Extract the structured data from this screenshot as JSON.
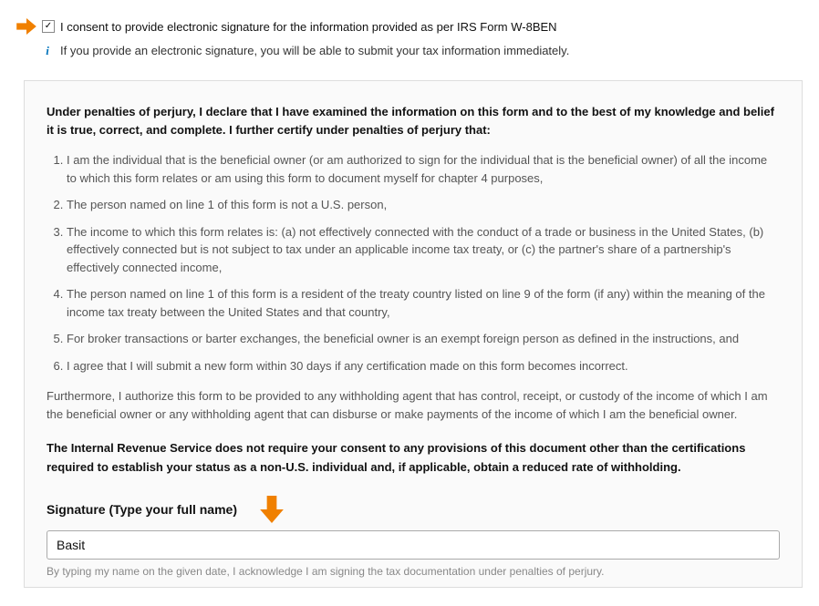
{
  "consent": {
    "checked": true,
    "label": "I consent to provide electronic signature for the information provided as per IRS Form W-8BEN"
  },
  "info": {
    "text": "If you provide an electronic signature, you will be able to submit your tax information immediately."
  },
  "panel": {
    "intro": "Under penalties of perjury, I declare that I have examined the information on this form and to the best of my knowledge and belief it is true, correct, and complete. I further certify under penalties of perjury that:",
    "items": [
      "I am the individual that is the beneficial owner (or am authorized to sign for the individual that is the beneficial owner) of all the income to which this form relates or am using this form to document myself for chapter 4 purposes,",
      "The person named on line 1 of this form is not a U.S. person,",
      "The income to which this form relates is: (a) not effectively connected with the conduct of a trade or business in the United States, (b) effectively connected but is not subject to tax under an applicable income tax treaty, or (c) the partner's share of a partnership's effectively connected income,",
      "The person named on line 1 of this form is a resident of the treaty country listed on line 9 of the form (if any) within the meaning of the income tax treaty between the United States and that country,",
      "For broker transactions or barter exchanges, the beneficial owner is an exempt foreign person as defined in the instructions, and",
      "I agree that I will submit a new form within 30 days if any certification made on this form becomes incorrect."
    ],
    "furthermore": "Furthermore, I authorize this form to be provided to any withholding agent that has control, receipt, or custody of the income of which I am the beneficial owner or any withholding agent that can disburse or make payments of the income of which I am the beneficial owner.",
    "irs_note": "The Internal Revenue Service does not require your consent to any provisions of this document other than the certifications required to establish your status as a non-U.S. individual and, if applicable, obtain a reduced rate of withholding.",
    "signature": {
      "label": "Signature (Type your full name)",
      "value": "Basit",
      "ack": "By typing my name on the given date, I acknowledge I am signing the tax documentation under penalties of perjury."
    }
  },
  "colors": {
    "accent_orange": "#f08000"
  }
}
